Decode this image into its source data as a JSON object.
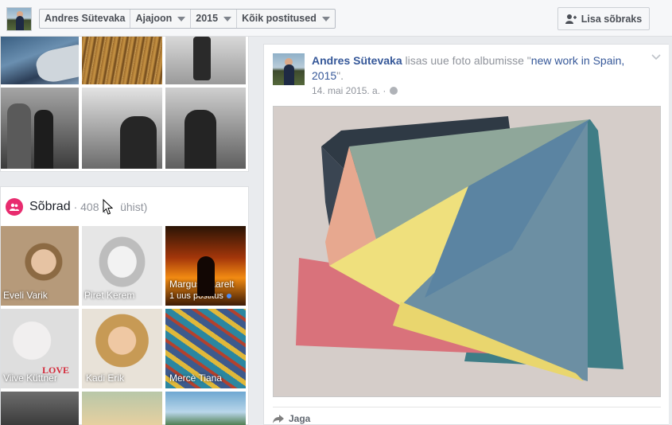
{
  "topbar": {
    "name": "Andres Sütevaka",
    "timeline": "Ajajoon",
    "year": "2015",
    "filter": "Kõik postitused",
    "add_friend": "Lisa sõbraks"
  },
  "friends": {
    "title": "Sõbrad",
    "count": "· 408 (",
    "mutual": "ühist)",
    "items": [
      {
        "name": "Eveli Varik"
      },
      {
        "name": "Piret Kerem"
      },
      {
        "name": "Margus Saarelt",
        "sub": "1 uus postitus"
      },
      {
        "name": "Viive Küttner",
        "badge": "LOVE"
      },
      {
        "name": "Kadi Erik"
      },
      {
        "name": "Mercè Tiana"
      }
    ]
  },
  "post": {
    "author": "Andres Sütevaka",
    "action": " lisas uue foto albumisse \"",
    "album": "new work in Spain, 2015",
    "end": "\".",
    "date": "14. mai 2015. a. ·",
    "share": "Jaga"
  },
  "icons": [
    "add-friend-icon",
    "friends-icon",
    "globe-icon",
    "share-icon",
    "chevron-down-icon",
    "caret-down-icon",
    "mouse-cursor-icon"
  ],
  "colors": {
    "link": "#365899",
    "friends_badge": "#e82c6f"
  }
}
